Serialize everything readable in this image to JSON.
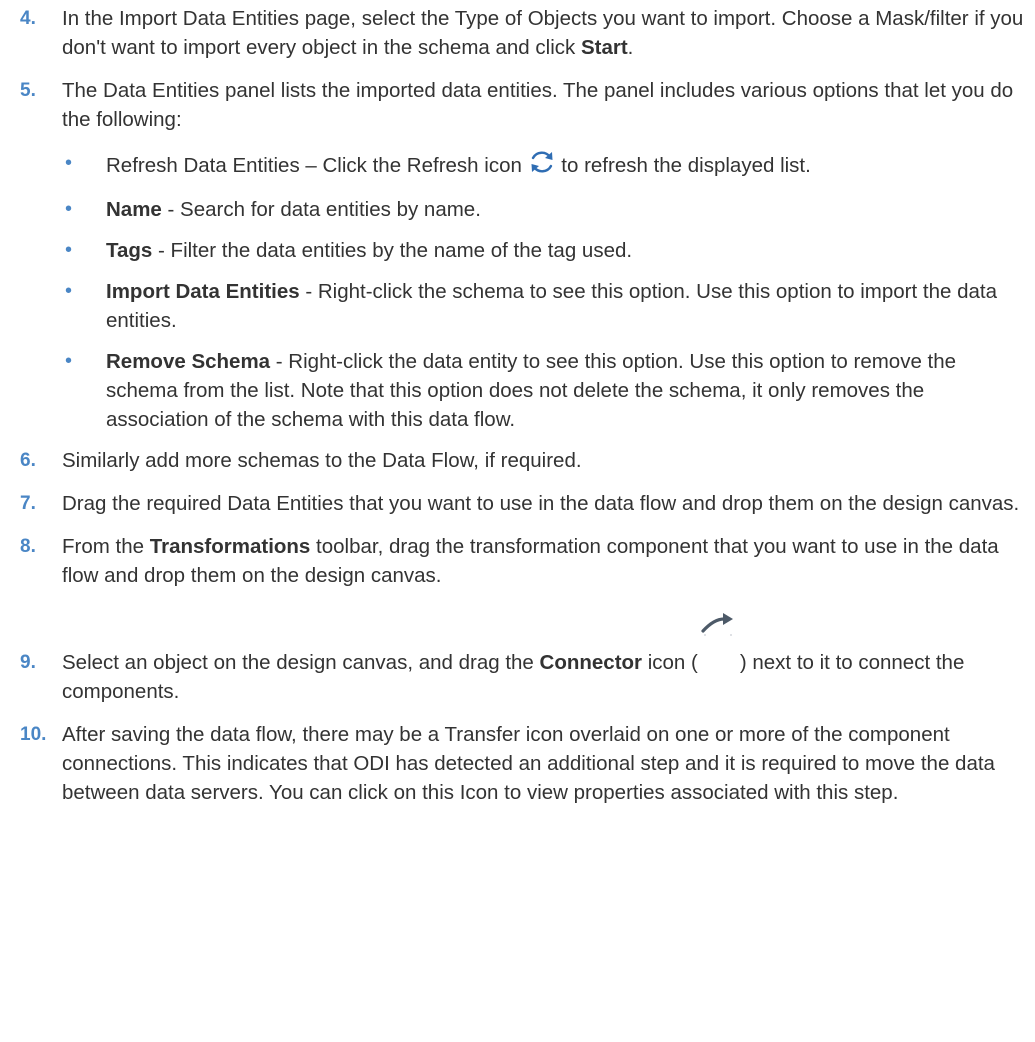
{
  "colors": {
    "step_number": "#4a86c5",
    "bullet": "#4a86c5",
    "text": "#333333",
    "refresh_icon": "#2f6db3"
  },
  "steps": [
    {
      "number": "4.",
      "parts": [
        "In the Import Data Entities page, select the Type of Objects you want to import. Choose a Mask/filter if you don't want to import every object in the schema and click ",
        "Start",
        "."
      ]
    },
    {
      "number": "5.",
      "text": "The Data Entities panel lists the imported data entities. The panel includes various options that let you do the following:",
      "bullets": [
        {
          "text_before": "Refresh Data Entities – Click the Refresh icon ",
          "icon": "refresh-icon",
          "text_after": "  to refresh the displayed list."
        },
        {
          "term": "Name",
          "desc": " - Search for data entities by name."
        },
        {
          "term": "Tags",
          "desc": " - Filter the data entities by the name of the tag used."
        },
        {
          "term": "Import Data Entities",
          "desc": " - Right-click the schema to see this option. Use this option to import the data entities."
        },
        {
          "term": "Remove Schema",
          "desc": " - Right-click the data entity to see this option. Use this option to remove the schema from the list. Note that this option does not delete the schema, it only removes the association of the schema with this data flow."
        }
      ]
    },
    {
      "number": "6.",
      "text": "Similarly add more schemas to the Data Flow, if required."
    },
    {
      "number": "7.",
      "text": "Drag the required Data Entities that you want to use in the data flow and drop them on the design canvas."
    },
    {
      "number": "8.",
      "parts": [
        "From the ",
        "Transformations",
        " toolbar, drag the transformation component that you want to use in the data flow and drop them on the design canvas."
      ]
    },
    {
      "number": "9.",
      "parts": [
        "Select an object on the design canvas, and drag the ",
        "Connector",
        " icon (",
        ") next to it to connect the components."
      ],
      "icon": "connector-icon"
    },
    {
      "number": "10.",
      "text": "After saving the data flow, there may be a Transfer icon overlaid on one or more of the component connections. This indicates that ODI has detected an additional step and it is required to move the data between data servers. You can click on this Icon to view properties associated with this step."
    }
  ]
}
